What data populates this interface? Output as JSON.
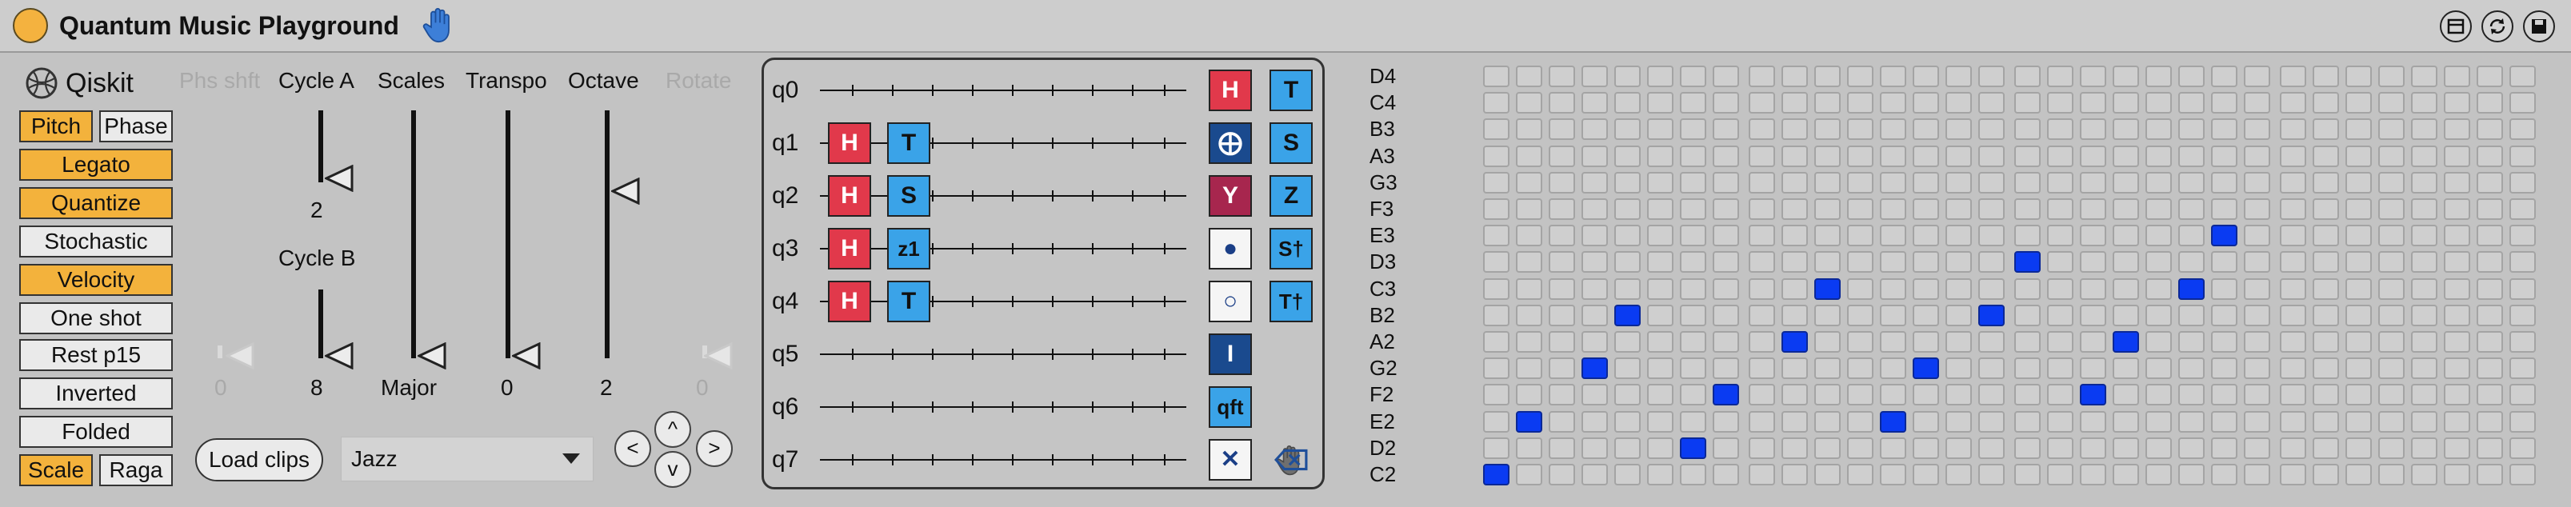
{
  "app": {
    "title": "Quantum Music Playground",
    "accent": "#f4b23f"
  },
  "logo": {
    "label": "Qiskit"
  },
  "toggles": [
    {
      "label": "Pitch",
      "on": true
    },
    {
      "label": "Phase",
      "on": false
    },
    {
      "label": "Legato",
      "on": true
    },
    {
      "label": "Quantize",
      "on": true
    },
    {
      "label": "Stochastic",
      "on": false
    },
    {
      "label": "Velocity",
      "on": true
    },
    {
      "label": "One shot",
      "on": false
    },
    {
      "label": "Rest p15",
      "on": false
    },
    {
      "label": "Inverted",
      "on": false
    },
    {
      "label": "Folded",
      "on": false
    },
    {
      "label": "Scale",
      "on": true
    },
    {
      "label": "Raga",
      "on": false
    }
  ],
  "sliders": {
    "phs_shft": {
      "label": "Phs shft",
      "value": "0"
    },
    "cycle_a": {
      "label": "Cycle A",
      "value": "2"
    },
    "cycle_b": {
      "label": "Cycle B",
      "value": "8"
    },
    "scales": {
      "label": "Scales",
      "value": "Major"
    },
    "transpo": {
      "label": "Transpo",
      "value": "0"
    },
    "octave": {
      "label": "Octave",
      "value": "2"
    },
    "rotate": {
      "label": "Rotate",
      "value": "0"
    }
  },
  "load_clips": {
    "label": "Load clips"
  },
  "clip_select": {
    "value": "Jazz"
  },
  "nav": {
    "up": "^",
    "down": "v",
    "left": "<",
    "right": ">"
  },
  "circuit": {
    "qubits": [
      "q0",
      "q1",
      "q2",
      "q3",
      "q4",
      "q5",
      "q6",
      "q7"
    ],
    "placed": [
      {
        "qubit": 1,
        "slot": 0,
        "label": "H",
        "kind": "red"
      },
      {
        "qubit": 1,
        "slot": 1,
        "label": "T",
        "kind": "blue"
      },
      {
        "qubit": 2,
        "slot": 0,
        "label": "H",
        "kind": "red"
      },
      {
        "qubit": 2,
        "slot": 1,
        "label": "S",
        "kind": "blue"
      },
      {
        "qubit": 3,
        "slot": 0,
        "label": "H",
        "kind": "red"
      },
      {
        "qubit": 3,
        "slot": 1,
        "label": "z1",
        "kind": "blue"
      },
      {
        "qubit": 4,
        "slot": 0,
        "label": "H",
        "kind": "red"
      },
      {
        "qubit": 4,
        "slot": 1,
        "label": "T",
        "kind": "blue"
      }
    ],
    "palette": [
      {
        "label": "H",
        "kind": "red"
      },
      {
        "label": "T",
        "kind": "blue"
      },
      {
        "label": "⨁",
        "kind": "dark"
      },
      {
        "label": "S",
        "kind": "blue"
      },
      {
        "label": "Y",
        "kind": "crim"
      },
      {
        "label": "Z",
        "kind": "blue"
      },
      {
        "label": "●",
        "kind": "white"
      },
      {
        "label": "S†",
        "kind": "blue"
      },
      {
        "label": "○",
        "kind": "white"
      },
      {
        "label": "T†",
        "kind": "blue"
      },
      {
        "label": "I",
        "kind": "dark"
      },
      {
        "label": "qft",
        "kind": "blue"
      },
      {
        "label": "✕",
        "kind": "white"
      }
    ],
    "palette_icons": [
      "hand-icon",
      "backspace-icon"
    ]
  },
  "piano_roll": {
    "notes": [
      "D4",
      "C4",
      "B3",
      "A3",
      "G3",
      "F3",
      "E3",
      "D3",
      "C3",
      "B2",
      "A2",
      "G2",
      "F2",
      "E2",
      "D2",
      "C2"
    ],
    "columns": 32,
    "active": [
      {
        "step": 0,
        "note": "C2"
      },
      {
        "step": 1,
        "note": "E2"
      },
      {
        "step": 3,
        "note": "G2"
      },
      {
        "step": 4,
        "note": "B2"
      },
      {
        "step": 6,
        "note": "D2"
      },
      {
        "step": 7,
        "note": "F2"
      },
      {
        "step": 9,
        "note": "A2"
      },
      {
        "step": 10,
        "note": "C3"
      },
      {
        "step": 12,
        "note": "E2"
      },
      {
        "step": 13,
        "note": "G2"
      },
      {
        "step": 15,
        "note": "B2"
      },
      {
        "step": 16,
        "note": "D3"
      },
      {
        "step": 18,
        "note": "F2"
      },
      {
        "step": 19,
        "note": "A2"
      },
      {
        "step": 21,
        "note": "C3"
      },
      {
        "step": 22,
        "note": "E3"
      }
    ],
    "active_color": "#0a3bf2"
  }
}
